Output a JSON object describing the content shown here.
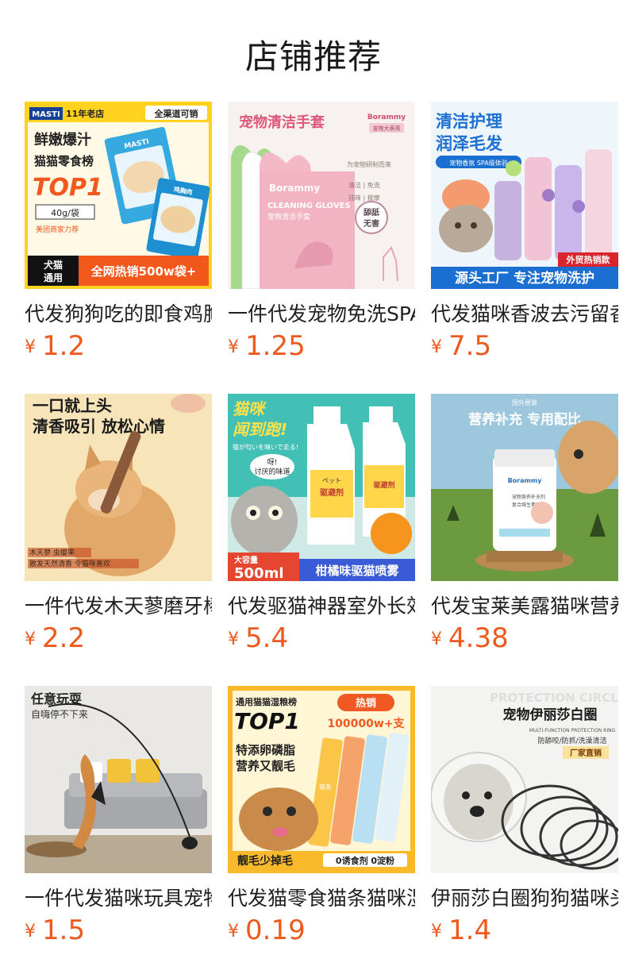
{
  "page": {
    "title": "店铺推荐"
  },
  "currency": "¥",
  "accent": "#ee5a1e",
  "products": [
    {
      "name": "代发狗狗吃的即食鸡胸肉",
      "price": "1.2",
      "image": {
        "brand": "MASTI",
        "brand_sub": "麦斯蒂",
        "badge": "11年老店",
        "corner": "全渠道可销",
        "l1": "鲜嫩爆汁",
        "l2": "猫猫零食榜",
        "l3": "TOP1",
        "pack": "鸡胸肉",
        "l4": "40g/袋",
        "l5": "美团商家力荐",
        "tag1": "犬猫",
        "tag2": "通用",
        "banner": "全网热销500w袋+"
      }
    },
    {
      "name": "一件代发宠物免洗SPA手套",
      "price": "1.25",
      "image": {
        "title": "宠物清洁手套",
        "brand": "Borammy",
        "brand_sub": "宠物大表哥",
        "pack_title": "CLEANING GLOVES",
        "pack_sub": "宠物清洁手套",
        "note": "为宠物研制而来",
        "f1": "清洁 | 免洗",
        "f2": "祛味 | 按摩",
        "seal1": "舔舐",
        "seal2": "无害"
      }
    },
    {
      "name": "代发猫咪香波去污留香沐浴露",
      "price": "7.5",
      "image": {
        "l1": "清洁护理",
        "l2": "润泽毛发",
        "pill": "宠物香氛 SPA级体验",
        "tag": "外贸热销款",
        "banner": "源头工厂 专注宠物洗护"
      }
    },
    {
      "name": "一件代发木天蓼磨牙棒猫薄荷",
      "price": "2.2",
      "image": {
        "l1": "一口就上头",
        "l2": "清香吸引 放松心情",
        "b1": "木天蓼 虫瘿果",
        "b2": "散发天然清香 令猫咪喜欢"
      }
    },
    {
      "name": "代发驱猫神器室外长效喷雾",
      "price": "5.4",
      "image": {
        "l1": "猫咪",
        "l2": "闻到跑!",
        "l3": "猫が匂いを嗅いで走る!",
        "bubble1": "呀!",
        "bubble2": "讨厌的味道",
        "bottle_jp": "ペット",
        "bottle": "驱避剂",
        "vol1": "大容量",
        "vol2": "500ml",
        "banner": "柑橘味驱猫喷雾"
      }
    },
    {
      "name": "代发宝莱美露猫咪营养补充片",
      "price": "4.38",
      "image": {
        "top": "国外原装",
        "l1": "营养补充 专用配比",
        "brand": "Borammy",
        "label1": "宠物营养补充剂",
        "label2": "复合维生素片"
      }
    },
    {
      "name": "一件代发猫咪玩具宠物逗猫棒",
      "price": "1.5",
      "image": {
        "l1": "任意玩耍",
        "l2": "自嗨停不下来"
      }
    },
    {
      "name": "代发猫零食猫条猫咪湿粮包",
      "price": "0.19",
      "image": {
        "top": "通用猫猫湿粮榜",
        "l1": "TOP1",
        "hot": "热销",
        "sold": "100000w+支",
        "l2": "特添卵磷脂",
        "l3": "营养又靓毛",
        "stick": "猫条",
        "banner1": "靓毛少掉毛",
        "banner2": "0诱食剂 0淀粉"
      }
    },
    {
      "name": "伊丽莎白圈狗狗猫咪头套",
      "price": "1.4",
      "image": {
        "bg": "PROTECTION CIRCLE",
        "l1": "宠物伊丽莎白圈",
        "l2": "MULTI-FUNCTION PROTECTION RING",
        "l3": "防舔咬/防抓/洗澡清洁",
        "tag": "厂家直销"
      }
    }
  ]
}
